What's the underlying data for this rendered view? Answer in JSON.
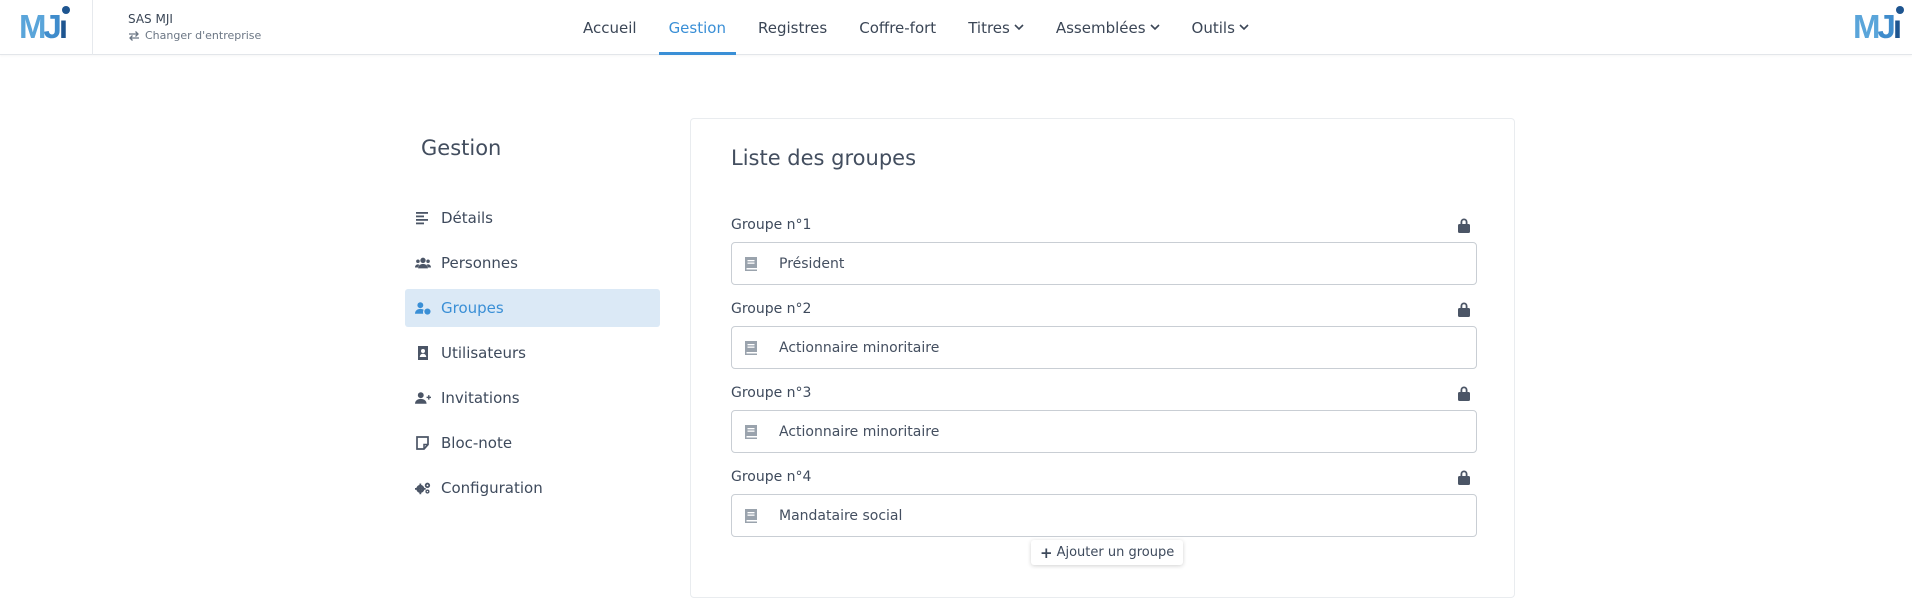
{
  "header": {
    "logo_text": "MJi",
    "company_name": "SAS MJI",
    "switch_label": "Changer d'entreprise",
    "nav": [
      {
        "label": "Accueil",
        "dropdown": false
      },
      {
        "label": "Gestion",
        "dropdown": false,
        "active": true
      },
      {
        "label": "Registres",
        "dropdown": false
      },
      {
        "label": "Coffre-fort",
        "dropdown": false
      },
      {
        "label": "Titres",
        "dropdown": true
      },
      {
        "label": "Assemblées",
        "dropdown": true
      },
      {
        "label": "Outils",
        "dropdown": true
      }
    ],
    "accent_color": "#3a8fd6"
  },
  "sidebar": {
    "title": "Gestion",
    "items": [
      {
        "label": "Détails",
        "icon": "align-left-icon"
      },
      {
        "label": "Personnes",
        "icon": "users-icon"
      },
      {
        "label": "Groupes",
        "icon": "user-group-icon",
        "active": true
      },
      {
        "label": "Utilisateurs",
        "icon": "contact-book-icon"
      },
      {
        "label": "Invitations",
        "icon": "user-plus-icon"
      },
      {
        "label": "Bloc-note",
        "icon": "sticky-note-icon"
      },
      {
        "label": "Configuration",
        "icon": "cogs-icon"
      }
    ]
  },
  "main": {
    "title": "Liste des groupes",
    "groups": [
      {
        "label": "Groupe n°1",
        "value": "Président"
      },
      {
        "label": "Groupe n°2",
        "value": "Actionnaire minoritaire"
      },
      {
        "label": "Groupe n°3",
        "value": "Actionnaire minoritaire"
      },
      {
        "label": "Groupe n°4",
        "value": "Mandataire social"
      }
    ],
    "add_button_label": "Ajouter un groupe"
  }
}
